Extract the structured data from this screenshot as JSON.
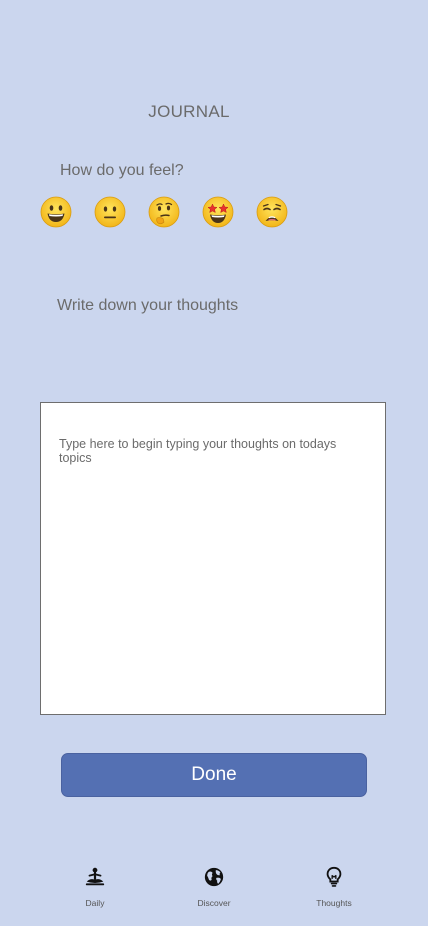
{
  "header": {
    "title": "JOURNAL"
  },
  "mood": {
    "prompt": "How do you feel?",
    "options": [
      {
        "icon": "grinning-face-icon",
        "label": "happy"
      },
      {
        "icon": "neutral-face-icon",
        "label": "neutral"
      },
      {
        "icon": "thinking-face-icon",
        "label": "thinking"
      },
      {
        "icon": "star-struck-face-icon",
        "label": "excited"
      },
      {
        "icon": "weary-face-icon",
        "label": "tired"
      }
    ]
  },
  "thoughts": {
    "prompt": "Write down your thoughts",
    "placeholder": "Type here to begin typing your thoughts on todays topics",
    "value": ""
  },
  "actions": {
    "done_label": "Done"
  },
  "tabbar": {
    "tabs": [
      {
        "label": "Daily",
        "icon": "meditation-icon"
      },
      {
        "label": "Discover",
        "icon": "globe-icon"
      },
      {
        "label": "Thoughts",
        "icon": "lightbulb-icon"
      }
    ]
  },
  "colors": {
    "background": "#cbd6ee",
    "button": "#5470b3",
    "text": "#6b6b6b"
  }
}
